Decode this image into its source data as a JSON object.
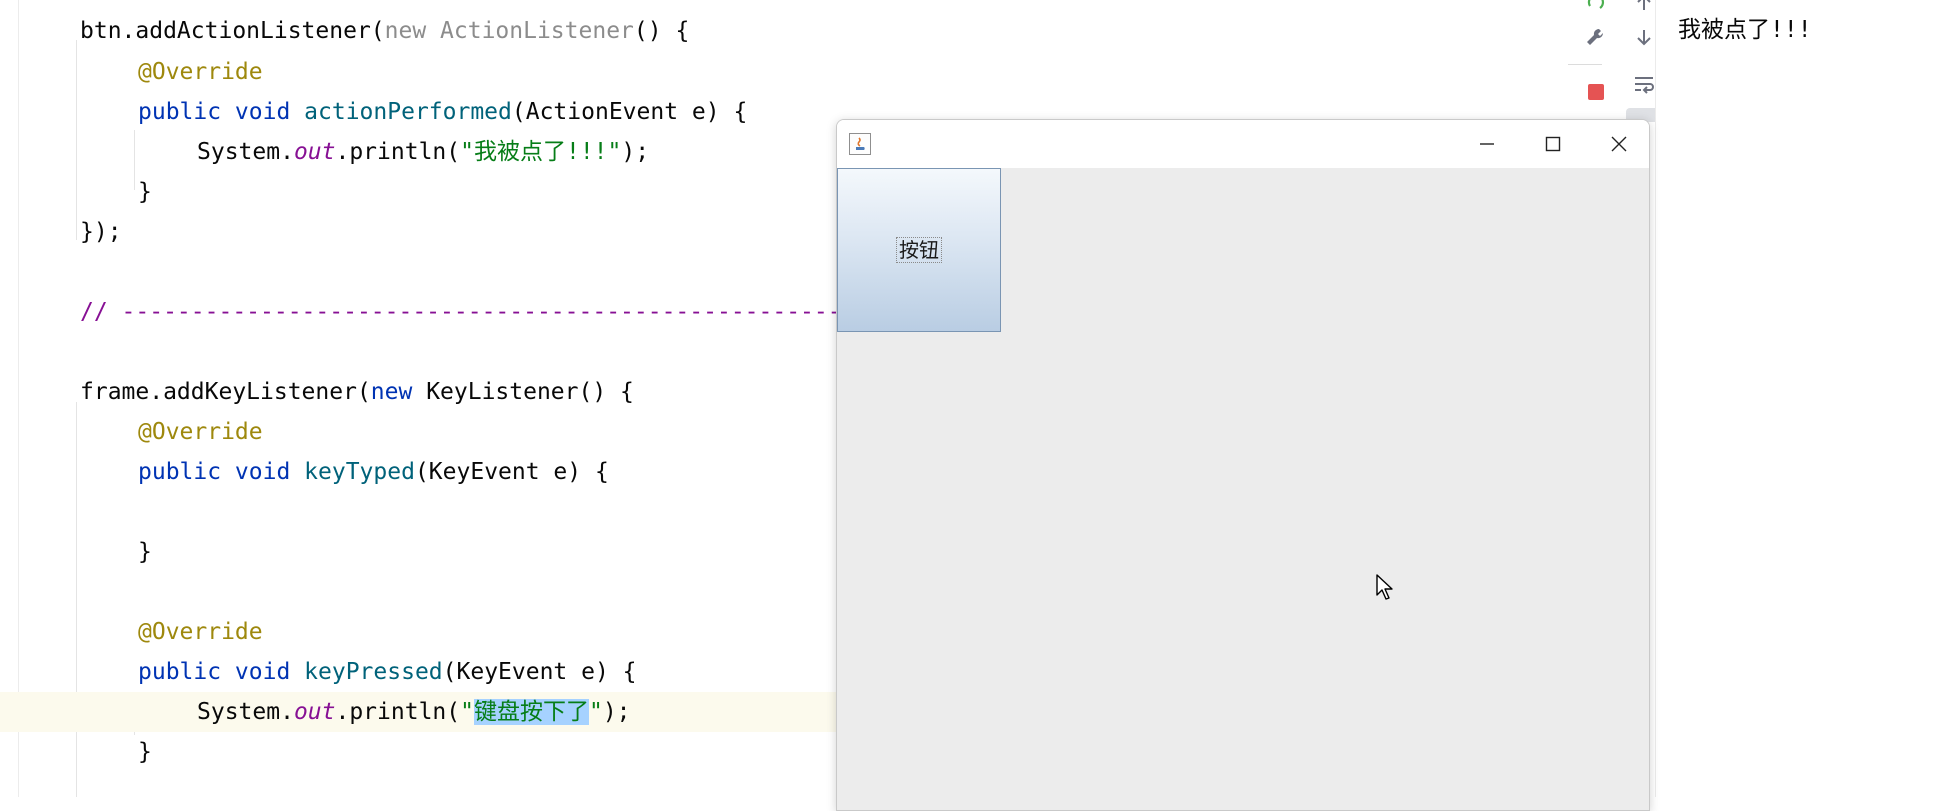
{
  "editor": {
    "lines": [
      {
        "a": "btn.addActionListener(",
        "b": "new ",
        "c": "ActionListener",
        "d": "() {"
      },
      {
        "ann": "@Override"
      },
      {
        "kw": "public void ",
        "fn": "actionPerformed",
        "rest": "(ActionEvent e) {"
      },
      {
        "pre": "System.",
        "fld": "out",
        "mid": ".println(",
        "q1": "\"",
        "str": "我被点了!!!",
        "q2": "\"",
        "end": ");"
      },
      {
        "text": "}"
      },
      {
        "text": "});"
      },
      {
        "comment": "// ------------------------------------------------------------------------"
      },
      {
        "a": "frame.addKeyListener(",
        "b": "new ",
        "c": "KeyListener",
        "d": "() {"
      },
      {
        "ann": "@Override"
      },
      {
        "kw": "public void ",
        "fn": "keyTyped",
        "rest": "(KeyEvent e) {"
      },
      {
        "text": "}"
      },
      {
        "ann": "@Override"
      },
      {
        "kw": "public void ",
        "fn": "keyPressed",
        "rest": "(KeyEvent e) {"
      },
      {
        "pre": "System.",
        "fld": "out",
        "mid": ".println(",
        "q1": "\"",
        "str": "键盘按下了",
        "q2": "\"",
        "end": ");"
      },
      {
        "text": "}"
      }
    ]
  },
  "console": {
    "output": "我被点了!!!"
  },
  "swing_window": {
    "button_label": "按钮"
  },
  "icons": {
    "tools": [
      "wrench-icon",
      "arrow-down-icon",
      "stop-icon",
      "soft-wrap-icon"
    ],
    "window": [
      "minimize-icon",
      "maximize-icon",
      "close-icon"
    ]
  },
  "colors": {
    "keyword": "#0033b3",
    "method": "#00627a",
    "annotation": "#9e880d",
    "string": "#067d17",
    "field": "#871094",
    "selection": "#a6d2ff",
    "stop": "#e55353"
  }
}
